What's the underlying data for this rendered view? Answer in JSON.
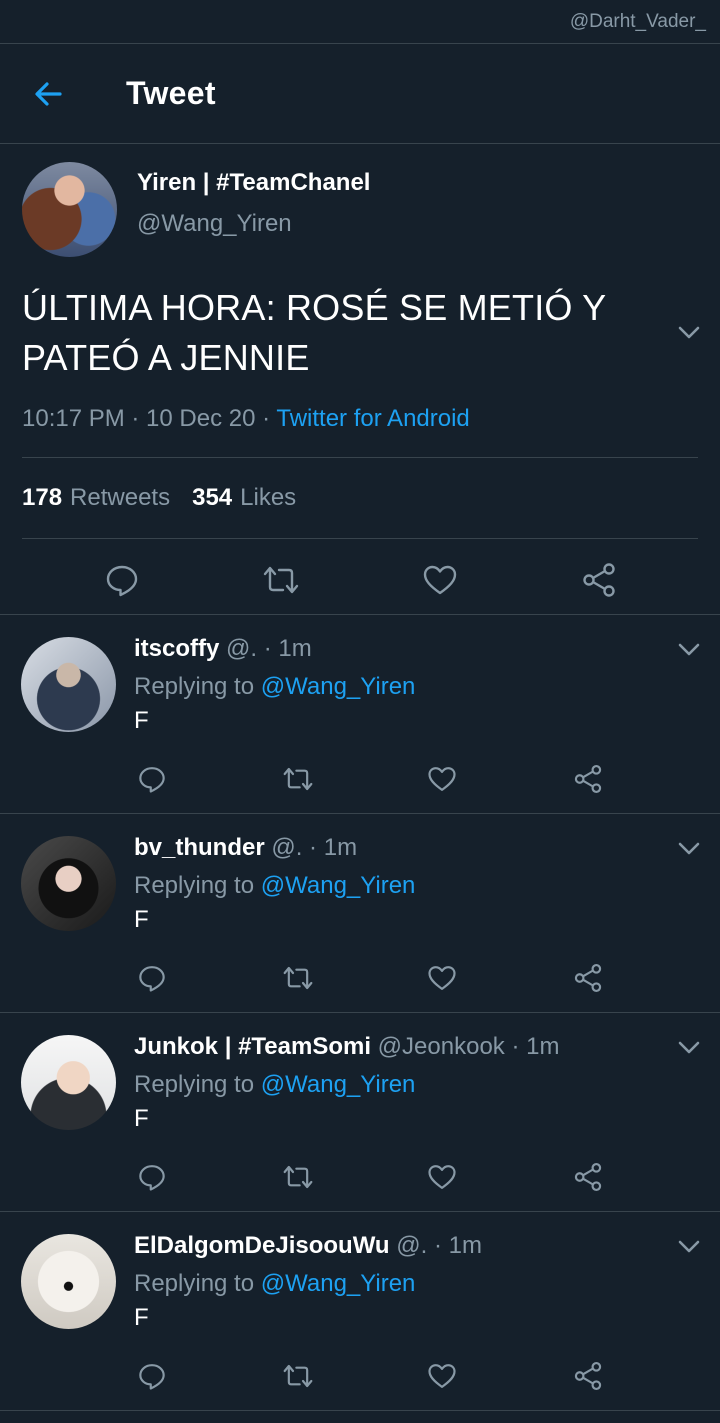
{
  "watermark": "@Darht_Vader_",
  "header": {
    "title": "Tweet"
  },
  "tweet": {
    "name": "Yiren | #TeamChanel",
    "handle": "@Wang_Yiren",
    "text": "ÚLTIMA HORA: ROSÉ SE METIÓ Y PATEÓ A JENNIE",
    "time": "10:17 PM · 10 Dec 20 · ",
    "source": "Twitter for Android",
    "retweets_count": "178",
    "retweets_label": "Retweets",
    "likes_count": "354",
    "likes_label": "Likes"
  },
  "replies": [
    {
      "name": "itscoffy",
      "meta": " @. · 1m",
      "replying_prefix": "Replying to ",
      "mention": "@Wang_Yiren",
      "text": "F"
    },
    {
      "name": "bv_thunder",
      "meta": " @. · 1m",
      "replying_prefix": "Replying to ",
      "mention": "@Wang_Yiren",
      "text": "F"
    },
    {
      "name": "Junkok | #TeamSomi",
      "meta": " @Jeonkook · 1m",
      "replying_prefix": "Replying to ",
      "mention": "@Wang_Yiren",
      "text": "F"
    },
    {
      "name": "ElDalgomDeJisoouWu",
      "meta": " @. · 1m",
      "replying_prefix": "Replying to ",
      "mention": "@Wang_Yiren",
      "text": "F"
    }
  ],
  "icons": {
    "back": "arrow-left-icon",
    "chevron": "chevron-down-icon",
    "reply": "comment-icon",
    "retweet": "retweet-icon",
    "like": "heart-icon",
    "share": "share-icon"
  },
  "colors": {
    "background": "#15202b",
    "accent": "#1da1f2",
    "secondary_text": "#8899a6",
    "divider": "#38444d"
  }
}
